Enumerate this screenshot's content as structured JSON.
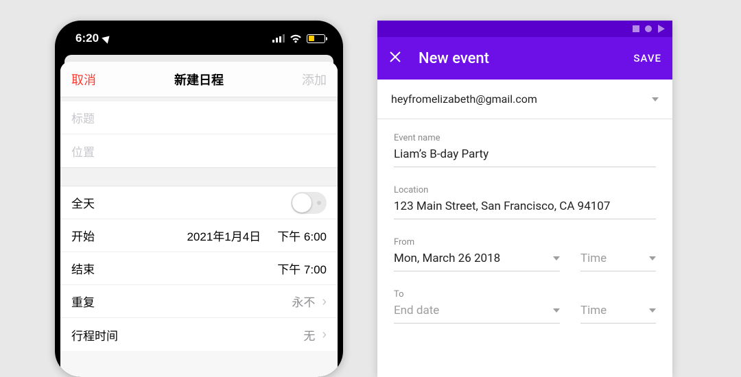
{
  "ios": {
    "status": {
      "time": "6:20"
    },
    "nav": {
      "cancel": "取消",
      "title": "新建日程",
      "add": "添加"
    },
    "fields": {
      "title_placeholder": "标题",
      "location_placeholder": "位置"
    },
    "rows": {
      "allday": "全天",
      "start": "开始",
      "start_date": "2021年1月4日",
      "start_time": "下午 6:00",
      "end": "结束",
      "end_time": "下午 7:00",
      "repeat": "重复",
      "repeat_value": "永不",
      "travel": "行程时间",
      "travel_value": "无"
    }
  },
  "android": {
    "appbar": {
      "title": "New event",
      "save": "SAVE"
    },
    "account": "heyfromelizabeth@gmail.com",
    "fields": {
      "event_name_label": "Event name",
      "event_name_value": "Liam’s B-day Party",
      "location_label": "Location",
      "location_value": "123 Main Street, San Francisco, CA 94107",
      "from_label": "From",
      "from_date": "Mon, March 26 2018",
      "from_time": "Time",
      "to_label": "To",
      "to_date": "End date",
      "to_time": "Time"
    }
  }
}
